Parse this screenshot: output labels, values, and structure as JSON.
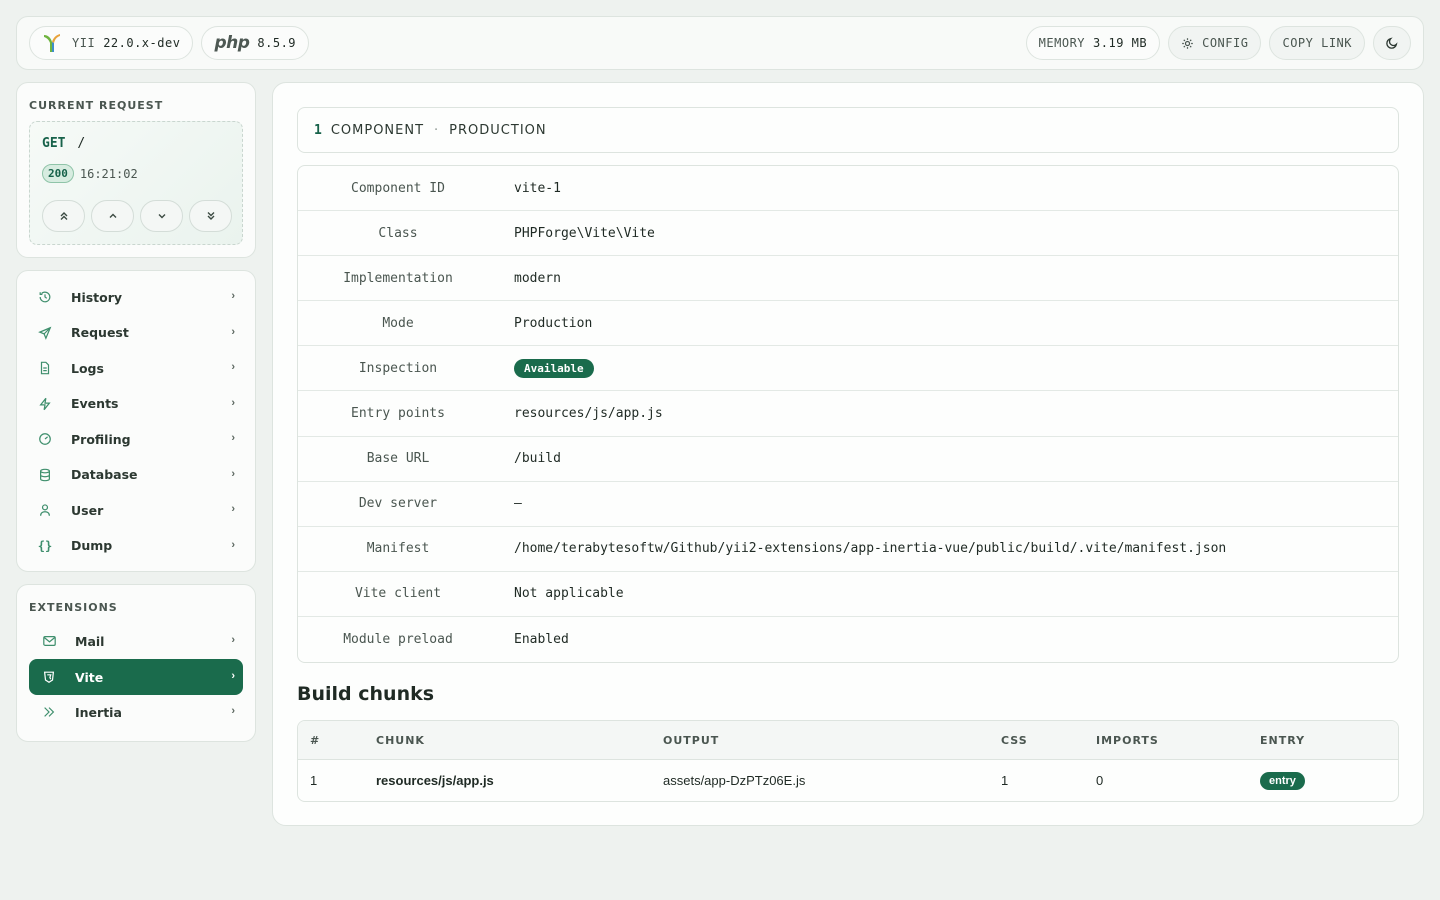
{
  "topbar": {
    "framework_label": "YII",
    "framework_version": "22.0.x-dev",
    "php_label": "php",
    "php_version": "8.5.9",
    "memory_label": "MEMORY",
    "memory_value": "3.19 MB",
    "config_label": "CONFIG",
    "copy_link_label": "COPY LINK"
  },
  "current_request": {
    "title": "CURRENT REQUEST",
    "method": "GET",
    "path": "/",
    "status": "200",
    "time": "16:21:02"
  },
  "menu": {
    "items": [
      {
        "label": "History",
        "icon": "history-icon"
      },
      {
        "label": "Request",
        "icon": "send-icon"
      },
      {
        "label": "Logs",
        "icon": "file-icon"
      },
      {
        "label": "Events",
        "icon": "lightning-icon"
      },
      {
        "label": "Profiling",
        "icon": "gauge-icon"
      },
      {
        "label": "Database",
        "icon": "database-icon"
      },
      {
        "label": "User",
        "icon": "user-icon"
      },
      {
        "label": "Dump",
        "icon": "braces-icon"
      }
    ]
  },
  "extensions": {
    "title": "EXTENSIONS",
    "items": [
      {
        "label": "Mail",
        "icon": "mail-icon"
      },
      {
        "label": "Vite",
        "icon": "shield-icon"
      },
      {
        "label": "Inertia",
        "icon": "double-chevron-icon"
      }
    ]
  },
  "component_bar": {
    "count": "1",
    "count_label": "COMPONENT",
    "separator": "·",
    "env": "PRODUCTION"
  },
  "properties": [
    {
      "key": "Component ID",
      "value": "vite-1"
    },
    {
      "key": "Class",
      "value": "PHPForge\\Vite\\Vite"
    },
    {
      "key": "Implementation",
      "value": "modern"
    },
    {
      "key": "Mode",
      "value": "Production"
    },
    {
      "key": "Inspection",
      "value": "Available"
    },
    {
      "key": "Entry points",
      "value": "resources/js/app.js"
    },
    {
      "key": "Base URL",
      "value": "/build"
    },
    {
      "key": "Dev server",
      "value": "—"
    },
    {
      "key": "Manifest",
      "value": "/home/terabytesoftw/Github/yii2-extensions/app-inertia-vue/public/build/.vite/manifest.json"
    },
    {
      "key": "Vite client",
      "value": "Not applicable"
    },
    {
      "key": "Module preload",
      "value": "Enabled"
    }
  ],
  "build_chunks": {
    "title": "Build chunks",
    "headers": [
      "#",
      "CHUNK",
      "OUTPUT",
      "CSS",
      "IMPORTS",
      "ENTRY"
    ],
    "rows": [
      {
        "num": "1",
        "chunk": "resources/js/app.js",
        "output": "assets/app-DzPTz06E.js",
        "css": "1",
        "imports": "0",
        "entry": "entry"
      }
    ]
  },
  "colors": {
    "accent": "#1a6b4c",
    "background": "#eef2ef"
  }
}
